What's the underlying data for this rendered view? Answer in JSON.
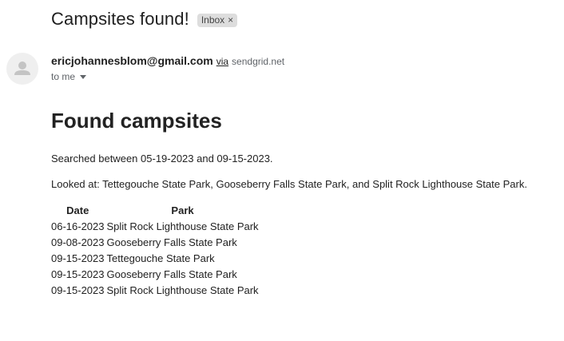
{
  "subject": "Campsites found!",
  "label_chip": {
    "text": "Inbox",
    "close": "×"
  },
  "sender": {
    "email": "ericjohannesblom@gmail.com",
    "via": "via",
    "via_domain": "sendgrid.net",
    "to": "to me"
  },
  "body": {
    "heading": "Found campsites",
    "searched": "Searched between 05-19-2023 and 09-15-2023.",
    "looked_at": "Looked at: Tettegouche State Park, Gooseberry Falls State Park, and Split Rock Lighthouse State Park."
  },
  "table": {
    "headers": [
      "Date",
      "Park"
    ],
    "rows": [
      [
        "06-16-2023",
        "Split Rock Lighthouse State Park"
      ],
      [
        "09-08-2023",
        "Gooseberry Falls State Park"
      ],
      [
        "09-15-2023",
        "Tettegouche State Park"
      ],
      [
        "09-15-2023",
        "Gooseberry Falls State Park"
      ],
      [
        "09-15-2023",
        "Split Rock Lighthouse State Park"
      ]
    ]
  },
  "icons": {
    "avatar": "person-icon",
    "recipient_menu": "chevron-down-icon",
    "chip_remove": "close-icon"
  }
}
